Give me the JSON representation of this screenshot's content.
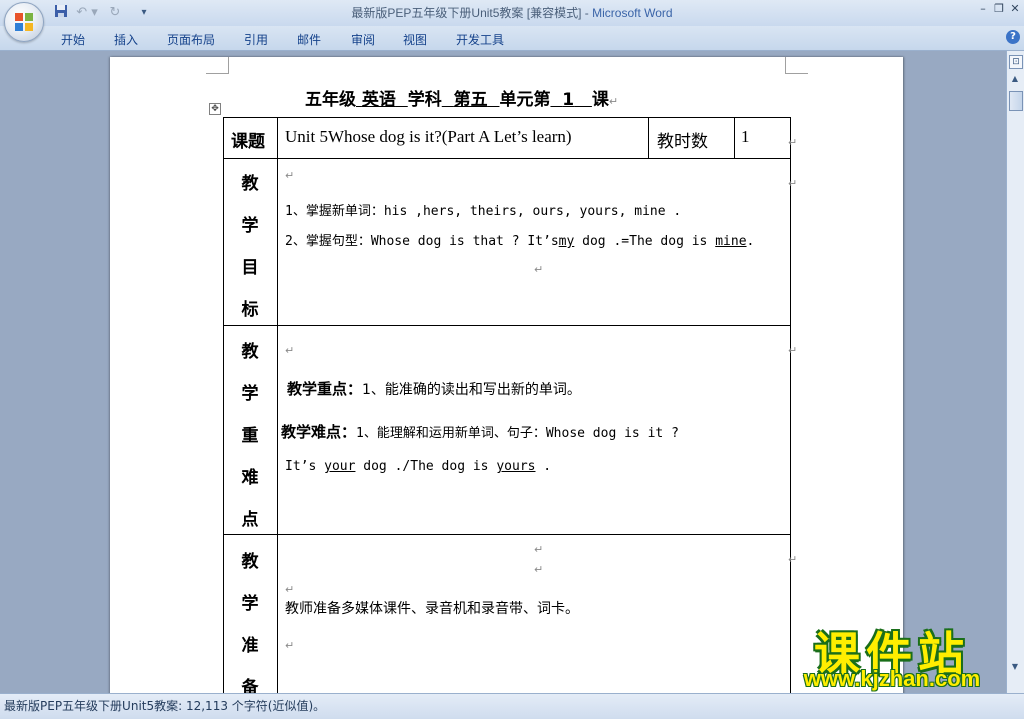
{
  "window": {
    "title_doc": "最新版PEP五年级下册Unit5教案 [兼容模式]",
    "title_sep": " - ",
    "title_app": "Microsoft Word",
    "min": "–",
    "max": "❐",
    "close": "✕"
  },
  "quick_access": {
    "save_icon": "save-icon",
    "undo_icon": "undo-icon",
    "redo_icon": "redo-icon"
  },
  "ribbon": {
    "tabs": [
      "开始",
      "插入",
      "页面布局",
      "引用",
      "邮件",
      "审阅",
      "视图",
      "开发工具"
    ],
    "help": "?"
  },
  "document": {
    "heading": {
      "p1": "五年级",
      "subject": "英语",
      "p2": "学科",
      "unit": "第五",
      "p3": "单元第",
      "lesson": "1",
      "p4": "课"
    },
    "table": {
      "topic_label": "课题",
      "topic_value": "Unit 5Whose dog is it?(Part A Let’s learn)",
      "hours_label": "教时数",
      "hours_value": "1",
      "goals": {
        "label_chars": [
          "教",
          "学",
          "目",
          "标"
        ],
        "line1": "1、掌握新单词：his ,hers, theirs, ours, yours, mine .",
        "line2_pre": "2、掌握句型：Whose dog is that ? It’s",
        "line2_u1": "my",
        "line2_mid": " dog .=The dog is ",
        "line2_u2": "mine",
        "line2_post": "."
      },
      "key_points": {
        "label_chars": [
          "教",
          "学",
          "重",
          "难",
          "点"
        ],
        "focus_label": "教学重点：",
        "focus_text": "1、能准确的读出和写出新的单词。",
        "diff_label": "教学难点：",
        "diff_text": "1、能理解和运用新单词、句子：Whose dog is it ?",
        "line3_pre": "It’s ",
        "line3_u1": "your",
        "line3_mid": " dog ./The dog is ",
        "line3_u2": "yours",
        "line3_post": " ."
      },
      "prep": {
        "label_chars": [
          "教",
          "学",
          "准",
          "备"
        ],
        "text": "教师准备多媒体课件、录音机和录音带、词卡。"
      }
    }
  },
  "status": {
    "text": "最新版PEP五年级下册Unit5教案: 12,113 个字符(近似值)。"
  },
  "watermark": {
    "title": "课件站",
    "url": "www.kjzhan.com"
  }
}
